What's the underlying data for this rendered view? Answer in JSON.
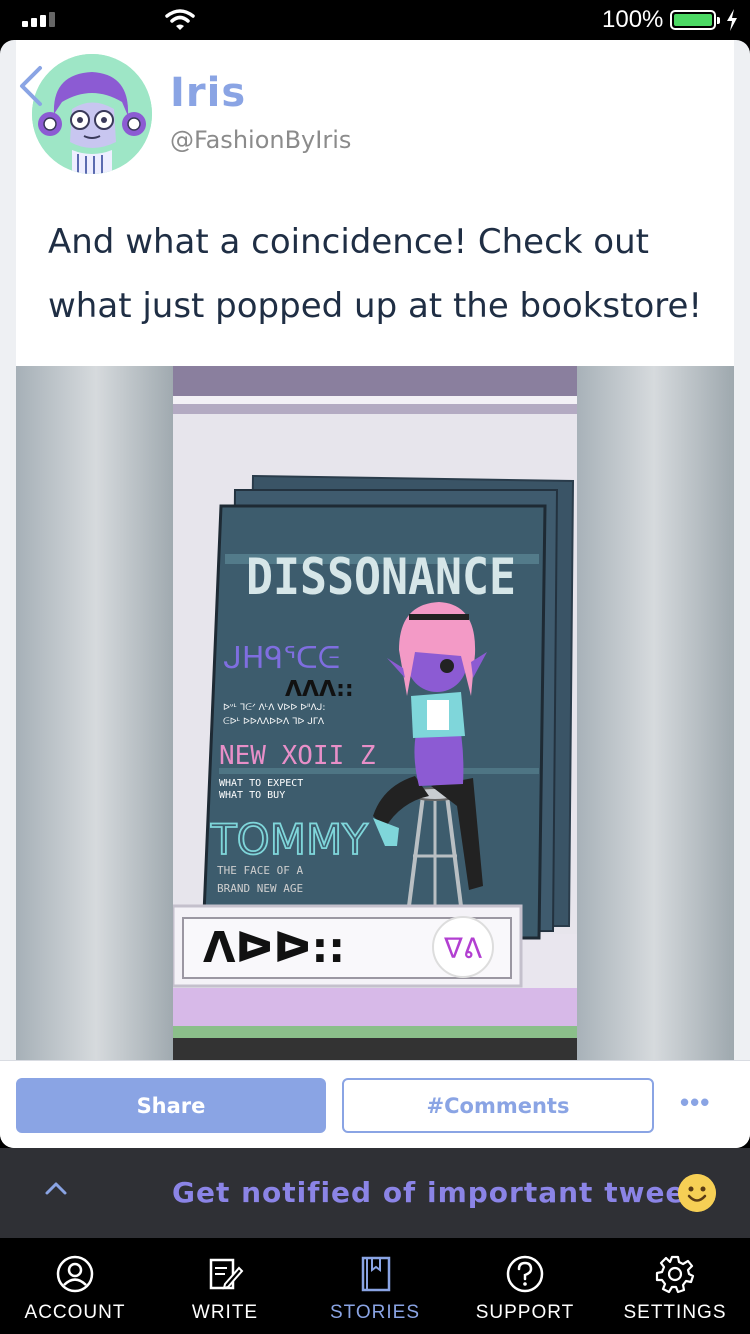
{
  "status_bar": {
    "battery_percent": "100%",
    "battery_color": "#4cd964"
  },
  "post": {
    "author_name": "Iris",
    "author_handle": "@FashionByIris",
    "text": "And what a coincidence! Check out what just popped up at the bookstore!",
    "accent_color": "#8aa4e4"
  },
  "comic": {
    "magazine_title": "DISSONANCE",
    "headline_1": "ᒍᕼᑫᕐᑕᕮ",
    "word_1": "ᐱᐱᐱ::",
    "blurb_1a": "ᐅᐡᒻ ᒣᕮᐟ ᐱᒻᐱ ᐯᐅᐅ ᐅᐦᐱᒍ:",
    "blurb_1b": "ᕮᐅᒻ ᐅᐅᐱᐱᐅᐅᐱ ᒣᐅ ᒍᒥᐱ",
    "headline_2": "NEW XOII Z",
    "blurb_2a": "WHAT TO EXPECT",
    "blurb_2b": "WHAT TO BUY",
    "headline_3": "TOMMY",
    "blurb_3a": "THE FACE OF A",
    "blurb_3b": "BRAND NEW AGE",
    "sign_text": "ᐱᐅᐅ::",
    "sign_badge": "ᐁᕕ"
  },
  "actions": {
    "share_label": "Share",
    "comments_label": "#Comments",
    "more_label": "•••"
  },
  "banner": {
    "text": "Get notified of important tweets"
  },
  "tabs": [
    {
      "label": "ACCOUNT",
      "icon": "account-icon"
    },
    {
      "label": "WRITE",
      "icon": "write-icon"
    },
    {
      "label": "STORIES",
      "icon": "book-icon",
      "active": true
    },
    {
      "label": "SUPPORT",
      "icon": "help-icon"
    },
    {
      "label": "SETTINGS",
      "icon": "gear-icon"
    }
  ]
}
